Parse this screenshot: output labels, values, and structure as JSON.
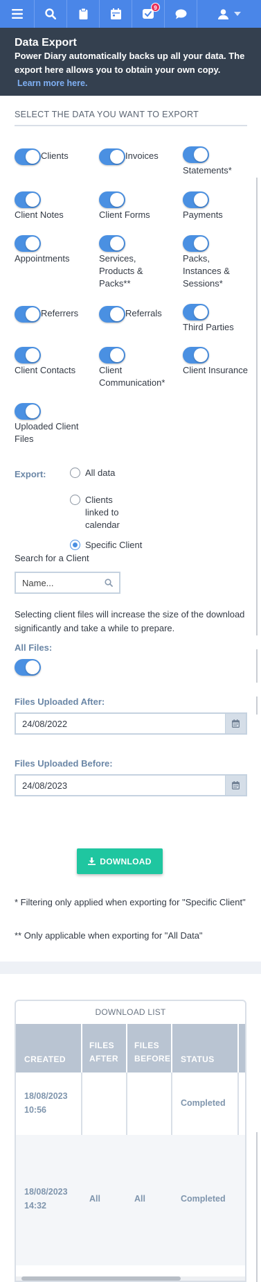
{
  "nav": {
    "notification_count": "9",
    "icons": [
      "menu-icon",
      "search-icon",
      "clipboard-icon",
      "calendar-icon",
      "tasks-icon",
      "chat-icon",
      "user-icon"
    ]
  },
  "banner": {
    "title": "Data Export",
    "description": "Power Diary automatically backs up all your data. The export here allows you to obtain your own copy.",
    "learn_more": "Learn more here."
  },
  "section_title": "SELECT THE DATA YOU WANT TO EXPORT",
  "toggles": [
    {
      "label": "Clients",
      "on": true
    },
    {
      "label": "Invoices",
      "on": true
    },
    {
      "label": "Statements*",
      "on": true
    },
    {
      "label": "Client Notes",
      "on": true
    },
    {
      "label": "Client Forms",
      "on": true
    },
    {
      "label": "Payments",
      "on": true
    },
    {
      "label": "Appointments",
      "on": true
    },
    {
      "label": "Services, Products & Packs**",
      "on": true
    },
    {
      "label": "Packs, Instances & Sessions*",
      "on": true
    },
    {
      "label": "Referrers",
      "on": true
    },
    {
      "label": "Referrals",
      "on": true
    },
    {
      "label": "Third Parties",
      "on": true
    },
    {
      "label": "Client Contacts",
      "on": true
    },
    {
      "label": "Client Communication*",
      "on": true
    },
    {
      "label": "Client Insurance",
      "on": true
    },
    {
      "label": "Uploaded Client Files",
      "on": true
    }
  ],
  "export": {
    "label": "Export:",
    "options": [
      {
        "label": "All data",
        "selected": false
      },
      {
        "label": "Clients linked to calendar",
        "selected": false
      },
      {
        "label": "Specific Client",
        "selected": true
      }
    ]
  },
  "search": {
    "label": "Search for a Client",
    "placeholder": "Name..."
  },
  "files_note": "Selecting client files will increase the size of the download significantly and take a while to prepare.",
  "all_files": {
    "label": "All Files:",
    "on": true
  },
  "files_after": {
    "label": "Files Uploaded After:",
    "value": "24/08/2022"
  },
  "files_before": {
    "label": "Files Uploaded Before:",
    "value": "24/08/2023"
  },
  "download_button": "DOWNLOAD",
  "footnotes": [
    "* Filtering only applied when exporting for \"Specific Client\"",
    "** Only applicable when exporting for \"All Data\""
  ],
  "download_list": {
    "title": "DOWNLOAD LIST",
    "columns": [
      "CREATED",
      "FILES AFTER",
      "FILES BEFORE",
      "STATUS"
    ],
    "rows": [
      {
        "created": "18/08/2023 10:56",
        "files_after": "",
        "files_before": "",
        "status": "Completed"
      },
      {
        "created": "18/08/2023 14:32",
        "files_after": "All",
        "files_before": "All",
        "status": "Completed"
      }
    ]
  },
  "colors": {
    "nav": "#4a86e8",
    "banner": "#34404f",
    "toggle_on": "#4a90e2",
    "download_button": "#1fc6a0",
    "label_blue": "#6a86a6"
  }
}
